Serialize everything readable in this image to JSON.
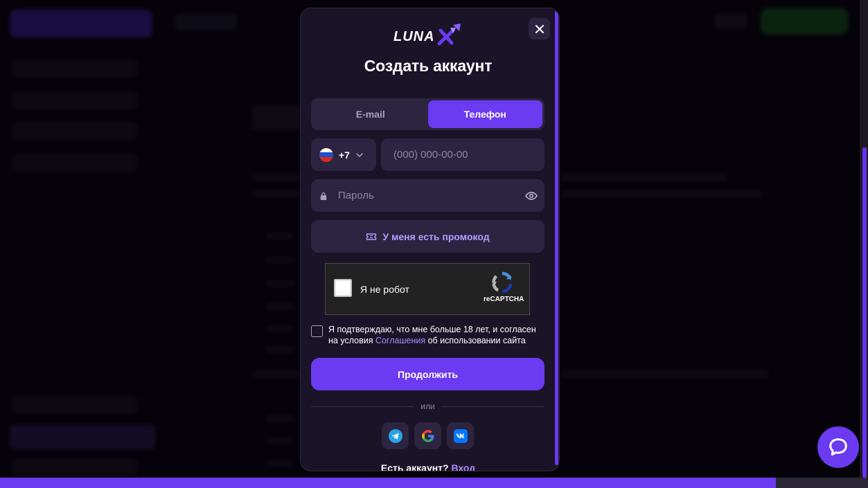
{
  "modal": {
    "title": "Создать аккаунт",
    "tabs": [
      {
        "label": "E-mail",
        "active": false
      },
      {
        "label": "Телефон",
        "active": true
      }
    ],
    "country_code": "+7",
    "phone_placeholder": "(000) 000-00-00",
    "password_placeholder": "Пароль",
    "promo_label": "У меня есть промокод",
    "captcha": {
      "label": "Я не робот",
      "brand": "reCAPTCHA"
    },
    "agree": {
      "text_before": "Я подтверждаю, что мне больше 18 лет, и согласен на условия ",
      "link": "Соглашения",
      "text_after": " об использовании сайта"
    },
    "continue_label": "Продолжить",
    "divider_label": "или",
    "footer": {
      "question": "Есть аккаунт?",
      "link": "Вход"
    }
  },
  "colors": {
    "accent": "#6b3af1",
    "modal_bg": "#1b1428",
    "field_bg": "#2d2442",
    "link": "#a98cff"
  },
  "icons": [
    "close-icon",
    "lunax-logo",
    "russia-flag-icon",
    "chevron-down-icon",
    "lock-icon",
    "eye-icon",
    "ticket-icon",
    "recaptcha-icon",
    "telegram-icon",
    "google-icon",
    "vk-icon",
    "chat-icon"
  ]
}
